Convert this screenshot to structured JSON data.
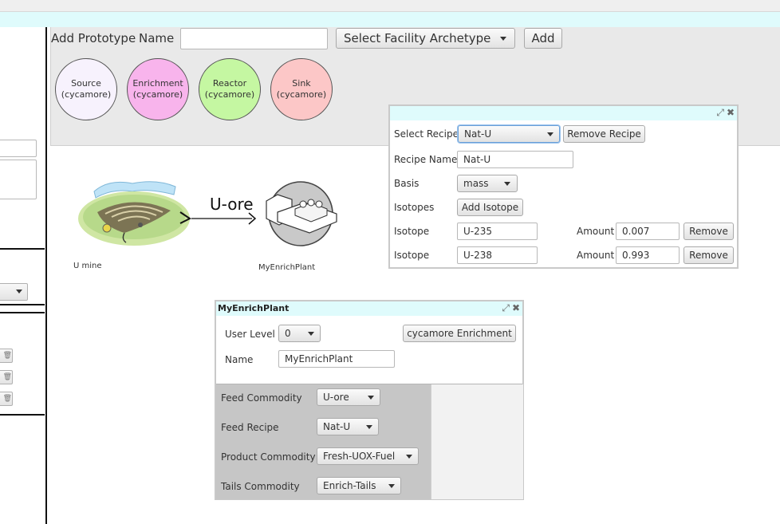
{
  "toolbar": {
    "add_prototype_label": "Add Prototype",
    "name_label": "Name",
    "name_value": "",
    "archetype_select": "Select Facility Archetype",
    "add_button": "Add"
  },
  "archetypes": [
    {
      "name": "Source",
      "lib": "(cycamore)",
      "color": "#f7f2fd"
    },
    {
      "name": "Enrichment",
      "lib": "(cycamore)",
      "color": "#f8b4ec"
    },
    {
      "name": "Reactor",
      "lib": "(cycamore)",
      "color": "#c5f7a2"
    },
    {
      "name": "Sink",
      "lib": "(cycamore)",
      "color": "#fcc7c7"
    }
  ],
  "canvas": {
    "mine_label": "U mine",
    "arrow_label": "U-ore",
    "enrich_label": "MyEnrichPlant"
  },
  "recipe_window": {
    "select_recipe_label": "Select Recipe",
    "selected_recipe": "Nat-U",
    "remove_recipe_button": "Remove Recipe",
    "recipe_name_label": "Recipe Name",
    "recipe_name_value": "Nat-U",
    "basis_label": "Basis",
    "basis_value": "mass",
    "isotopes_label": "Isotopes",
    "add_isotope_button": "Add Isotope",
    "isotopes": [
      {
        "label": "Isotope",
        "value": "U-235",
        "amount_label": "Amount",
        "amount": "0.007",
        "remove": "Remove"
      },
      {
        "label": "Isotope",
        "value": "U-238",
        "amount_label": "Amount",
        "amount": "0.993",
        "remove": "Remove"
      }
    ]
  },
  "facility_window": {
    "title": "MyEnrichPlant",
    "user_level_label": "User Level",
    "user_level_value": "0",
    "archetype_button": "cycamore Enrichment",
    "name_label": "Name",
    "name_value": "MyEnrichPlant",
    "params": [
      {
        "label": "Feed Commodity",
        "value": "U-ore"
      },
      {
        "label": "Feed Recipe",
        "value": "Nat-U"
      },
      {
        "label": "Product Commodity",
        "value": "Fresh-UOX-Fuel"
      },
      {
        "label": "Tails Commodity",
        "value": "Enrich-Tails"
      }
    ]
  },
  "colors": {
    "title_bar": "#dffbfc",
    "panel_grey": "#c6c6c6"
  }
}
